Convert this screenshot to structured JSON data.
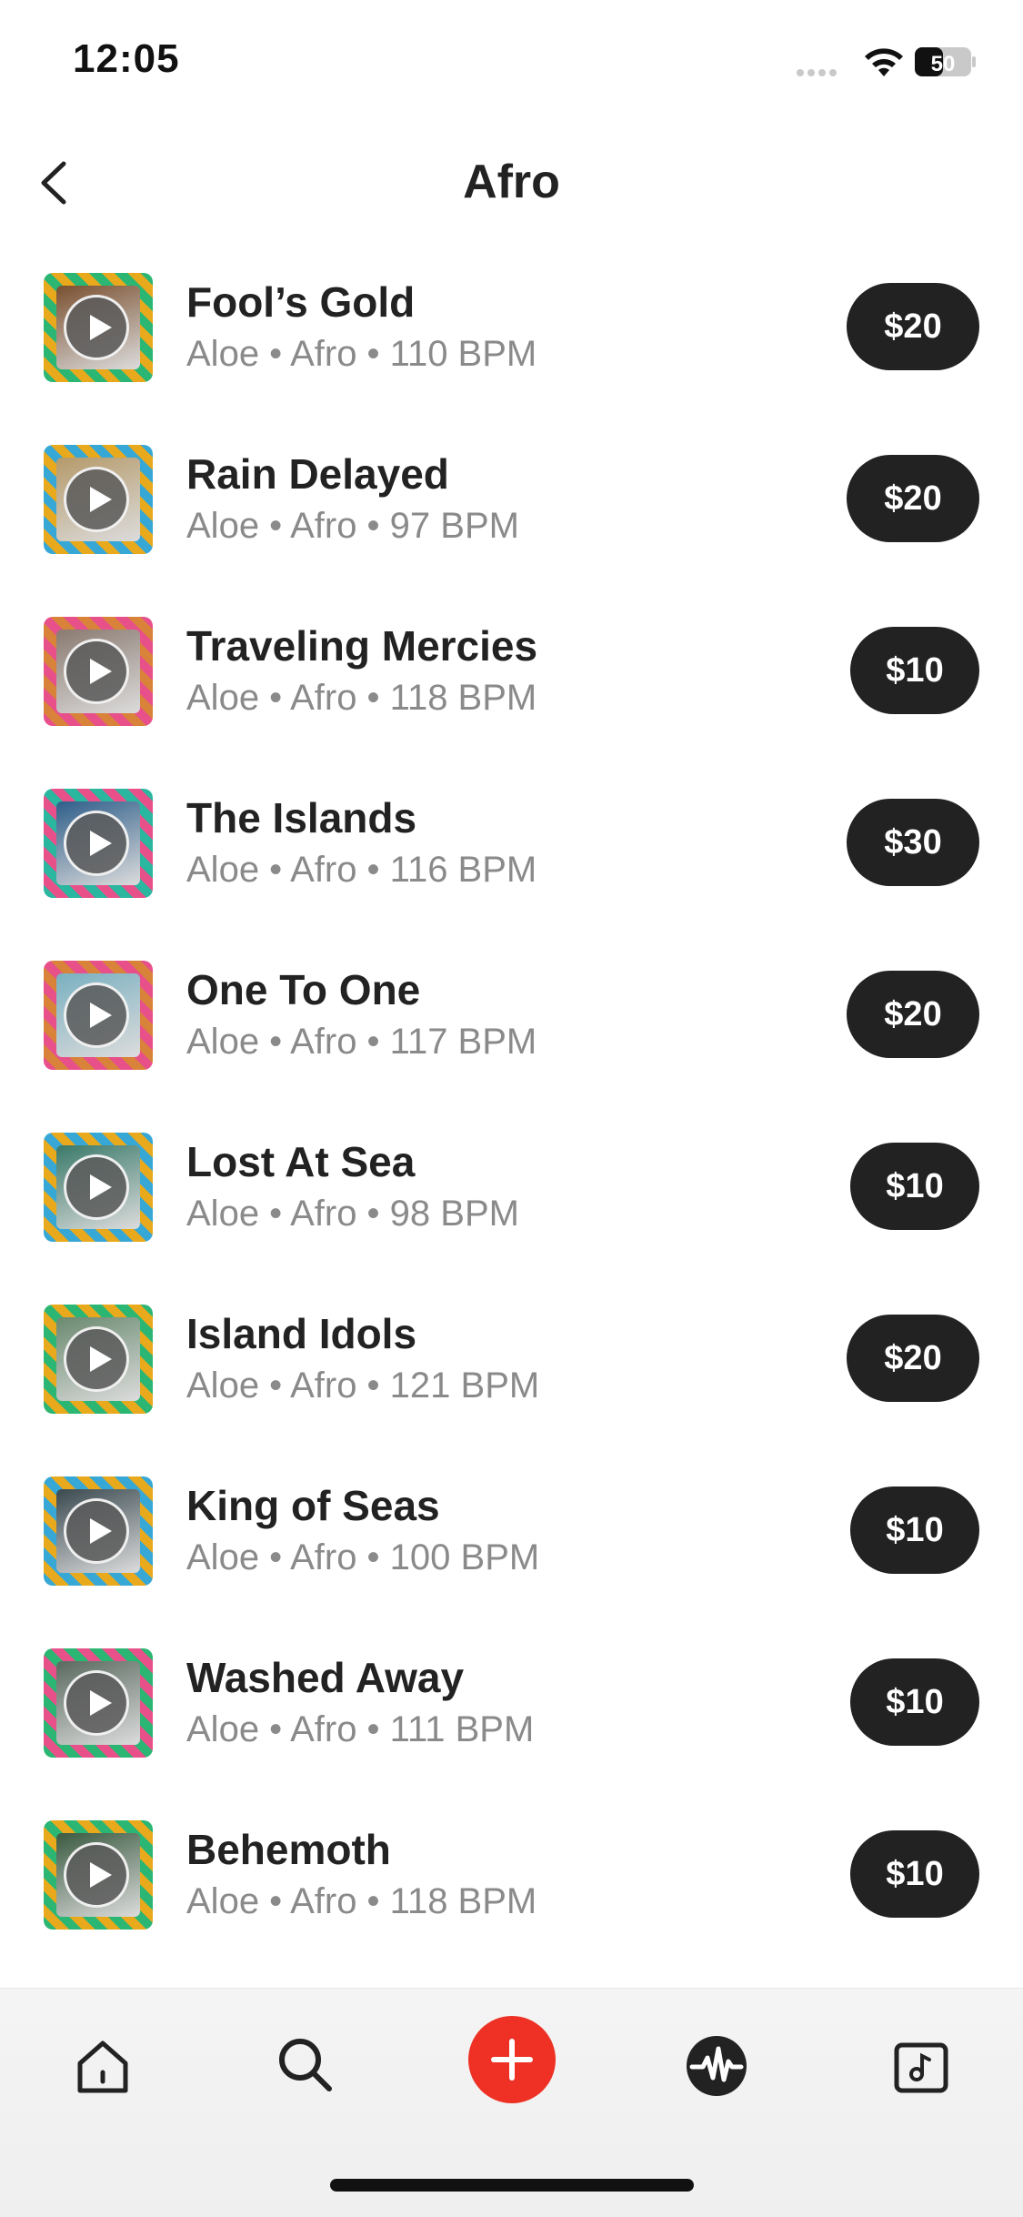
{
  "status_bar": {
    "time": "12:05",
    "battery": "50"
  },
  "header": {
    "title": "Afro"
  },
  "colors": {
    "price_bg": "#222222",
    "add_button": "#ee3124",
    "subtitle": "#8a8a8a"
  },
  "tracks": [
    {
      "title": "Fool’s Gold",
      "subtitle": "Aloe • Afro • 110 BPM",
      "price": "$20",
      "art": [
        "#2bb673",
        "#e8a91c",
        "#7a5030"
      ]
    },
    {
      "title": "Rain Delayed",
      "subtitle": "Aloe • Afro • 97 BPM",
      "price": "$20",
      "art": [
        "#37a8d6",
        "#e8a91c",
        "#b59a6a"
      ]
    },
    {
      "title": "Traveling Mercies",
      "subtitle": "Aloe • Afro • 118 BPM",
      "price": "$10",
      "art": [
        "#e8508a",
        "#d9823a",
        "#8a7a70"
      ]
    },
    {
      "title": "The Islands",
      "subtitle": "Aloe • Afro • 116 BPM",
      "price": "$30",
      "art": [
        "#2bb6a0",
        "#e8508a",
        "#2f5e8a"
      ]
    },
    {
      "title": "One To One",
      "subtitle": "Aloe • Afro • 117 BPM",
      "price": "$20",
      "art": [
        "#e8508a",
        "#d9823a",
        "#7ab0c0"
      ]
    },
    {
      "title": "Lost At Sea",
      "subtitle": "Aloe • Afro • 98 BPM",
      "price": "$10",
      "art": [
        "#37a8d6",
        "#e8a91c",
        "#3a7a6a"
      ]
    },
    {
      "title": "Island Idols",
      "subtitle": "Aloe • Afro • 121 BPM",
      "price": "$20",
      "art": [
        "#2bb673",
        "#e8a91c",
        "#6a8a70"
      ]
    },
    {
      "title": "King of Seas",
      "subtitle": "Aloe • Afro • 100 BPM",
      "price": "$10",
      "art": [
        "#37a8d6",
        "#e8a91c",
        "#3a4a50"
      ]
    },
    {
      "title": "Washed Away",
      "subtitle": "Aloe • Afro • 111 BPM",
      "price": "$10",
      "art": [
        "#2bb673",
        "#e8508a",
        "#5a6a60"
      ]
    },
    {
      "title": "Behemoth",
      "subtitle": "Aloe • Afro • 118 BPM",
      "price": "$10",
      "art": [
        "#2bb673",
        "#e8a91c",
        "#3a5a40"
      ]
    }
  ],
  "tabbar": {
    "items": [
      {
        "icon": "home-icon"
      },
      {
        "icon": "search-icon"
      },
      {
        "icon": "add-icon"
      },
      {
        "icon": "activity-icon"
      },
      {
        "icon": "library-icon"
      }
    ]
  }
}
